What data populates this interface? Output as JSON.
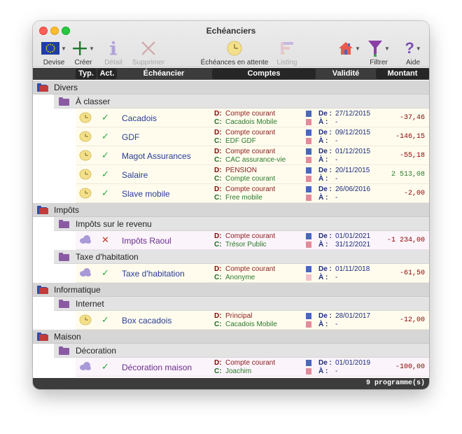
{
  "window": {
    "title": "Echéanciers"
  },
  "toolbar": {
    "devise": "Devise",
    "creer": "Créer",
    "detail": "Détail",
    "supprimer": "Supprimer",
    "attente": "Échéances en attente",
    "listing": "Listing",
    "filtrer": "Filtrer",
    "aide": "Aide"
  },
  "columns": {
    "typ": "Typ.",
    "act": "Act.",
    "echeancier": "Échéancier",
    "comptes": "Comptes",
    "validite": "Validité",
    "montant": "Montant"
  },
  "labels": {
    "d": "D:",
    "c": "C:",
    "de": "De :",
    "a": "À  :"
  },
  "groups": [
    {
      "name": "Divers",
      "subgroups": [
        {
          "name": "À classer",
          "rows": [
            {
              "name": "Cacadois",
              "debit": "Compte courant",
              "credit": "Cacadois Mobile",
              "de": "27/12/2015",
              "a": "-",
              "amount": "-37,46"
            },
            {
              "name": "GDF",
              "debit": "Compte courant",
              "credit": "EDF GDF",
              "de": "09/12/2015",
              "a": "-",
              "amount": "-146,15"
            },
            {
              "name": "Magot Assurances",
              "debit": "Compte courant",
              "credit": "CAC assurance-vie",
              "de": "01/12/2015",
              "a": "-",
              "amount": "-55,18"
            },
            {
              "name": "Salaire",
              "debit": "PENSION",
              "credit": "Compte courant",
              "de": "20/11/2015",
              "a": "-",
              "amount": "2 513,08"
            },
            {
              "name": "Slave mobile",
              "debit": "Compte courant",
              "credit": "Free mobile",
              "de": "26/06/2016",
              "a": "-",
              "amount": "-2,00"
            }
          ]
        }
      ]
    },
    {
      "name": "Impôts",
      "subgroups": [
        {
          "name": "Impôts sur le revenu",
          "rows": [
            {
              "name": "Impôts Raoul",
              "debit": "Compte courant",
              "credit": "Trésor Public",
              "de": "01/01/2021",
              "a": "31/12/2021",
              "amount": "-1 234,00"
            }
          ]
        },
        {
          "name": "Taxe d'habitation",
          "rows": [
            {
              "name": "Taxe d'habitation",
              "debit": "Compte courant",
              "credit": "Anonyme",
              "de": "01/11/2018",
              "a": "-",
              "amount": "-61,50"
            }
          ]
        }
      ]
    },
    {
      "name": "Informatique",
      "subgroups": [
        {
          "name": "Internet",
          "rows": [
            {
              "name": "Box cacadois",
              "debit": "Principal",
              "credit": "Cacadois Mobile",
              "de": "28/01/2017",
              "a": "-",
              "amount": "-12,00"
            }
          ]
        }
      ]
    },
    {
      "name": "Maison",
      "subgroups": [
        {
          "name": "Décoration",
          "rows": [
            {
              "name": "Décoration maison",
              "debit": "Compte courant",
              "credit": "Joachim",
              "de": "01/01/2019",
              "a": "-",
              "amount": "-100,00"
            }
          ]
        }
      ]
    }
  ],
  "footer": {
    "count": "9 programme(s)"
  },
  "colors": {
    "accent_purple": "#8a5ba3",
    "debit": "#8b0000",
    "credit": "#2a7a2a",
    "header": "#3c3c3c"
  }
}
